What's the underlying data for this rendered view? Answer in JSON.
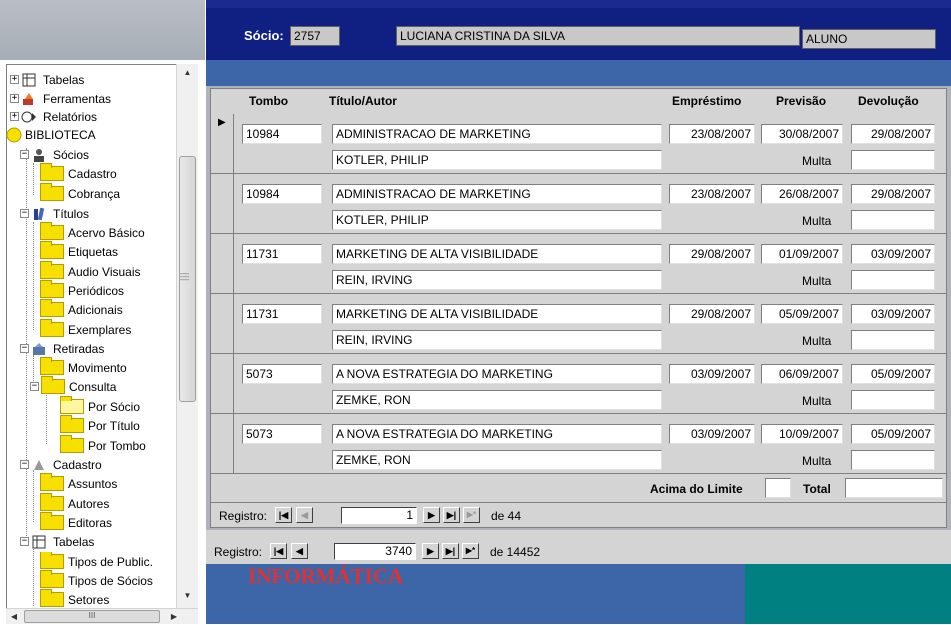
{
  "header": {
    "socio_label": "Sócio:",
    "socio_code": "2757",
    "socio_name": "LUCIANA CRISTINA DA SILVA",
    "socio_type": "ALUNO"
  },
  "tree": {
    "nodes": [
      {
        "label": "Tabelas",
        "depth": 0
      },
      {
        "label": "Ferramentas",
        "depth": 0
      },
      {
        "label": "Relatórios",
        "depth": 0
      },
      {
        "label": "BIBLIOTECA",
        "depth": 0
      },
      {
        "label": "Sócios",
        "depth": 1
      },
      {
        "label": "Cadastro",
        "depth": 2
      },
      {
        "label": "Cobrança",
        "depth": 2
      },
      {
        "label": "Títulos",
        "depth": 1
      },
      {
        "label": "Acervo Básico",
        "depth": 2
      },
      {
        "label": "Etiquetas",
        "depth": 2
      },
      {
        "label": "Audio Visuais",
        "depth": 2
      },
      {
        "label": "Periódicos",
        "depth": 2
      },
      {
        "label": "Adicionais",
        "depth": 2
      },
      {
        "label": "Exemplares",
        "depth": 2
      },
      {
        "label": "Retiradas",
        "depth": 1
      },
      {
        "label": "Movimento",
        "depth": 2
      },
      {
        "label": "Consulta",
        "depth": 2
      },
      {
        "label": "Por Sócio",
        "depth": 3
      },
      {
        "label": "Por Título",
        "depth": 3
      },
      {
        "label": "Por Tombo",
        "depth": 3
      },
      {
        "label": "Cadastro",
        "depth": 1
      },
      {
        "label": "Assuntos",
        "depth": 2
      },
      {
        "label": "Autores",
        "depth": 2
      },
      {
        "label": "Editoras",
        "depth": 2
      },
      {
        "label": "Tabelas",
        "depth": 1
      },
      {
        "label": "Tipos de Public.",
        "depth": 2
      },
      {
        "label": "Tipos de Sócios",
        "depth": 2
      },
      {
        "label": "Setores",
        "depth": 2
      }
    ],
    "hscroll_grip": "III"
  },
  "grid": {
    "columns": {
      "tombo": "Tombo",
      "titulo": "Título/Autor",
      "emprestimo": "Empréstimo",
      "previsao": "Previsão",
      "devolucao": "Devolução"
    },
    "multa_label": "Multa",
    "records": [
      {
        "tombo": "10984",
        "titulo": "ADMINISTRACAO DE MARKETING",
        "autor": "KOTLER, PHILIP",
        "emprestimo": "23/08/2007",
        "previsao": "30/08/2007",
        "devolucao": "29/08/2007"
      },
      {
        "tombo": "10984",
        "titulo": "ADMINISTRACAO DE MARKETING",
        "autor": "KOTLER, PHILIP",
        "emprestimo": "23/08/2007",
        "previsao": "26/08/2007",
        "devolucao": "29/08/2007"
      },
      {
        "tombo": "11731",
        "titulo": "MARKETING DE ALTA VISIBILIDADE",
        "autor": "REIN, IRVING",
        "emprestimo": "29/08/2007",
        "previsao": "01/09/2007",
        "devolucao": "03/09/2007"
      },
      {
        "tombo": "11731",
        "titulo": "MARKETING DE ALTA VISIBILIDADE",
        "autor": "REIN, IRVING",
        "emprestimo": "29/08/2007",
        "previsao": "05/09/2007",
        "devolucao": "03/09/2007"
      },
      {
        "tombo": "5073",
        "titulo": "A  NOVA ESTRATEGIA DO MARKETING",
        "autor": "ZEMKE, RON",
        "emprestimo": "03/09/2007",
        "previsao": "06/09/2007",
        "devolucao": "05/09/2007"
      },
      {
        "tombo": "5073",
        "titulo": "A  NOVA ESTRATEGIA DO MARKETING",
        "autor": "ZEMKE, RON",
        "emprestimo": "03/09/2007",
        "previsao": "10/09/2007",
        "devolucao": "05/09/2007"
      }
    ],
    "limit_label": "Acima do Limite",
    "total_label": "Total"
  },
  "sub_nav": {
    "label": "Registro:",
    "current": "1",
    "of_text": "de 44"
  },
  "main_nav": {
    "label": "Registro:",
    "current": "3740",
    "of_text": "de 14452"
  },
  "footer": {
    "brand_text": "INFORMÁTICA"
  },
  "colors": {
    "top_bar": "#0f1f82",
    "strip_blue": "#3c66a8",
    "teal": "#008080",
    "brand_red": "#e03030",
    "folder_yellow": "#f7e000"
  }
}
